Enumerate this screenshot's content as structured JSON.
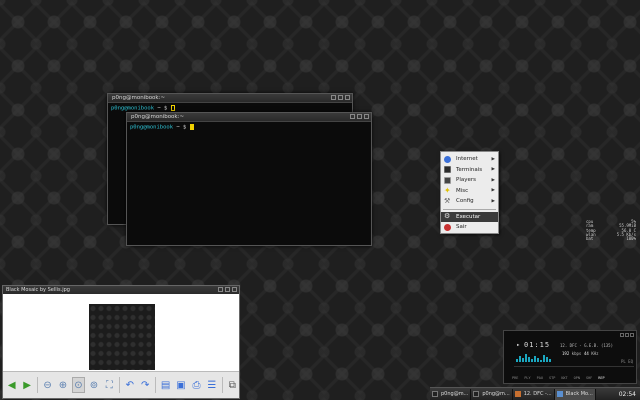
{
  "terminals": [
    {
      "title": "p0ng@monibook:~",
      "prompt_user": "p0ng@monibook",
      "prompt_path": " ~ $ "
    },
    {
      "title": "p0ng@monibook:~",
      "prompt_user": "p0ng@monibook",
      "prompt_path": " ~ $ "
    }
  ],
  "menu": {
    "items": [
      {
        "label": "Internet",
        "icon": "globe-icon",
        "color": "#3a6fd8",
        "submenu": true
      },
      {
        "label": "Terminais",
        "icon": "terminal-icon",
        "color": "#2a2a2a",
        "submenu": true
      },
      {
        "label": "Players",
        "icon": "film-icon",
        "color": "#444444",
        "submenu": true
      },
      {
        "label": "Misc",
        "icon": "star-icon",
        "color": "#e0c000",
        "submenu": true
      },
      {
        "label": "Config",
        "icon": "wrench-icon",
        "color": "#777777",
        "submenu": true
      }
    ],
    "execute_label": "Executar",
    "exit_label": "Sair"
  },
  "stats": [
    {
      "label": "cpu",
      "value": "5%"
    },
    {
      "label": "ram",
      "value": "55.9MiB"
    },
    {
      "label": "temp",
      "value": "56.0 C"
    },
    {
      "label": "wlan",
      "value": "5.5 Kb/s"
    },
    {
      "label": "bat",
      "value": "100%"
    }
  ],
  "viewer": {
    "title": "Black Mosaic by Sellis.jpg",
    "toolbar_icons": [
      "arrow-left-icon",
      "arrow-right-icon",
      "zoom-out-icon",
      "zoom-in-icon",
      "zoom-fit-icon",
      "zoom-original-icon",
      "fullscreen-icon",
      "rotate-left-icon",
      "rotate-right-icon",
      "open-file-icon",
      "save-icon",
      "print-icon",
      "preferences-icon",
      "slideshow-icon"
    ]
  },
  "player": {
    "time": "01:15",
    "song": "12. DFC - G.E.B. (135)",
    "kbps_value": "192",
    "kbps_label": "kbps",
    "khz_value": "44",
    "khz_label": "KHz",
    "volume_label": "PL EQ",
    "visualizer": [
      3,
      6,
      4,
      8,
      5,
      3,
      6,
      4,
      2,
      7,
      5,
      3
    ],
    "buttons": [
      "PRE",
      "PLY",
      "PAU",
      "STP",
      "NXT",
      "OPN",
      "SHF",
      "REP"
    ]
  },
  "panel": {
    "tasks": [
      {
        "label": "p0ng@m...",
        "icon": "terminal-icon",
        "active": false
      },
      {
        "label": "p0ng@m...",
        "icon": "terminal-icon",
        "active": false
      },
      {
        "label": "12. DFC -...",
        "icon": "music-icon",
        "active": false
      },
      {
        "label": "Black Mo...",
        "icon": "image-icon",
        "active": true
      }
    ],
    "clock": "02:54"
  }
}
